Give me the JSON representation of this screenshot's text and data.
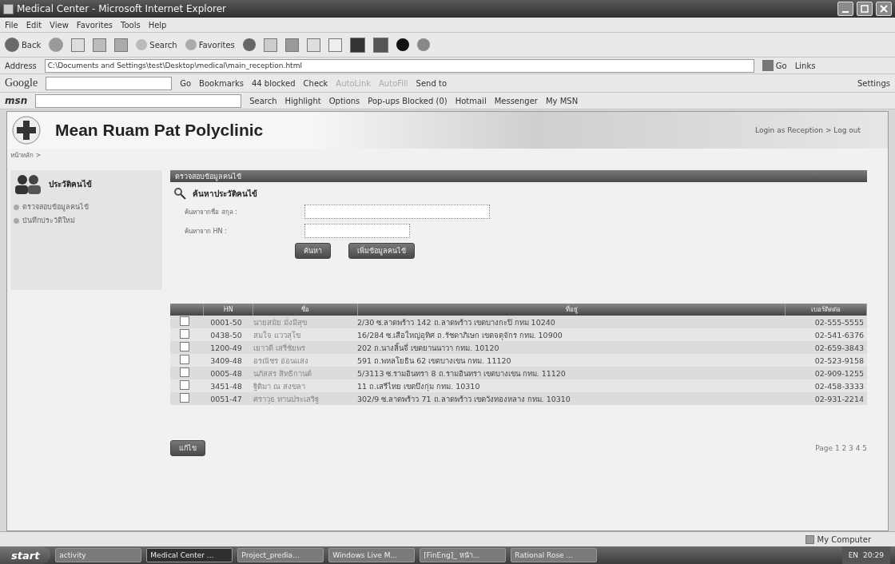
{
  "window": {
    "title": "Medical Center - Microsoft Internet Explorer"
  },
  "menu": [
    "File",
    "Edit",
    "View",
    "Favorites",
    "Tools",
    "Help"
  ],
  "toolbar": {
    "back": "Back",
    "search": "Search",
    "favorites": "Favorites"
  },
  "address": {
    "label": "Address",
    "value": "C:\\Documents and Settings\\test\\Desktop\\medical\\main_reception.html",
    "go": "Go",
    "links": "Links"
  },
  "google_bar": {
    "logo": "Google",
    "go": "Go",
    "items": [
      "Bookmarks",
      "44 blocked",
      "Check",
      "AutoLink",
      "AutoFill",
      "Send to"
    ],
    "settings": "Settings"
  },
  "msn_bar": {
    "logo": "msn",
    "items": [
      "Search",
      "Highlight",
      "Options",
      "Pop-ups Blocked (0)",
      "Hotmail",
      "Messenger",
      "My MSN"
    ]
  },
  "page": {
    "title": "Mean Ruam Pat Polyclinic",
    "login": "Login as Reception > Log out",
    "breadcrumb": "หน้าหลัก >"
  },
  "sidebar": {
    "title": "ประวัติคนไข้",
    "items": [
      "ตรวจสอบข้อมูลคนไข้",
      "บันทึกประวัติใหม่"
    ]
  },
  "panel": {
    "header": "ตรวจสอบข้อมูลคนไข้",
    "heading": "ค้นหาประวัติคนไข้",
    "fields": [
      {
        "label": "ค้นหาจากชื่อ สกุล :",
        "wide": true
      },
      {
        "label": "ค้นหาจาก HN :",
        "wide": false
      }
    ],
    "buttons": [
      "ค้นหา",
      "เพิ่มข้อมูลคนไข้"
    ]
  },
  "table": {
    "columns": [
      "HN",
      "ชื่อ",
      "ที่อยู่",
      "เบอร์ติดต่อ"
    ],
    "rows": [
      {
        "checked": false,
        "cells": [
          "0001-50",
          "นายสมัย มั่งมีสุข",
          "2/30 ซ.ลาดพร้าว 142 ถ.ลาดพร้าว เขตบางกะปิ กทม 10240",
          "02-555-5555"
        ]
      },
      {
        "checked": false,
        "cells": [
          "0438-50",
          "สมใจ แววสุโข",
          "16/284 ซ.เสือใหญ่อุทิศ ถ.รัชดาภิเษก เขตจตุจักร กทม. 10900",
          "02-541-6376"
        ]
      },
      {
        "checked": false,
        "cells": [
          "1200-49",
          "เยาวดี เสรีชัยพร",
          "202 ถ.นางลิ้นจี่ เขตยานนาวา กทม. 10120",
          "02-659-3843"
        ]
      },
      {
        "checked": false,
        "cells": [
          "3409-48",
          "อรณัชร อ่อนแสง",
          "591 ถ.พหลโยธิน 62 เขตบางเขน กทม. 11120",
          "02-523-9158"
        ]
      },
      {
        "checked": false,
        "cells": [
          "0005-48",
          "นภัสสร สิทธิกานต์",
          "5/3113 ซ.รามอินทรา 8 ถ.รามอินทรา เขตบางเขน กทม. 11120",
          "02-909-1255"
        ]
      },
      {
        "checked": false,
        "cells": [
          "3451-48",
          "ฐิติมา ณ สงขลา",
          "11 ถ.เสรีไทย เขตบึงกุ่ม กทม. 10310",
          "02-458-3333"
        ]
      },
      {
        "checked": false,
        "cells": [
          "0051-47",
          "ศราวุธ ทานประเสริฐ",
          "302/9 ซ.ลาดพร้าว 71 ถ.ลาดพร้าว เขตวังทองหลาง กทม. 10310",
          "02-931-2214"
        ]
      }
    ]
  },
  "edit_button": "แก้ไข",
  "pager": "Page 1 2 3 4 5",
  "status_bar": {
    "zone": "My Computer"
  },
  "taskbar": {
    "start": "start",
    "tasks": [
      {
        "label": "activity",
        "selected": false
      },
      {
        "label": "Medical Center ...",
        "selected": true
      },
      {
        "label": "Project_predia...",
        "selected": false
      },
      {
        "label": "Windows Live M...",
        "selected": false
      },
      {
        "label": "[FinEng]_ หน้า...",
        "selected": false
      },
      {
        "label": "Rational Rose ...",
        "selected": false
      }
    ],
    "language": "EN",
    "clock": "20:29"
  }
}
